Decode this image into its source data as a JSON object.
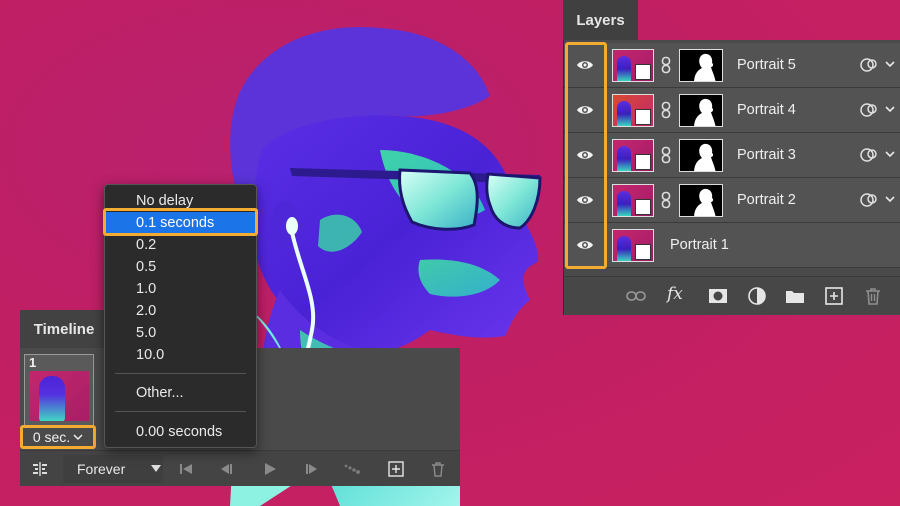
{
  "colors": {
    "background": "#c01f63",
    "panel": "#4a4a4a",
    "highlight_orange": "#f4ab31",
    "menu_selected_blue": "#1b74e8"
  },
  "layers_panel": {
    "title": "Layers",
    "layers": [
      {
        "name": "Portrait 5",
        "visible": true,
        "has_mask": true
      },
      {
        "name": "Portrait 4",
        "visible": true,
        "has_mask": true
      },
      {
        "name": "Portrait 3",
        "visible": true,
        "has_mask": true
      },
      {
        "name": "Portrait 2",
        "visible": true,
        "has_mask": true
      },
      {
        "name": "Portrait 1",
        "visible": true,
        "has_mask": false
      }
    ],
    "footer_icons": [
      "link-icon",
      "fx-icon",
      "add-mask-icon",
      "adjustment-layer-icon",
      "new-group-icon",
      "new-layer-icon",
      "trash-icon"
    ],
    "fx_label": "fx"
  },
  "timeline_panel": {
    "title": "Timeline",
    "frames": [
      {
        "number": "1",
        "delay": "0 sec."
      }
    ],
    "loop_option": "Forever",
    "controls": [
      "convert-to-video-icon",
      "first-frame-icon",
      "previous-frame-icon",
      "play-icon",
      "next-frame-icon",
      "tween-icon",
      "duplicate-frame-icon",
      "trash-icon"
    ]
  },
  "delay_menu": {
    "items": [
      {
        "label": "No delay",
        "selected": false
      },
      {
        "label": "0.1 seconds",
        "selected": true
      },
      {
        "label": "0.2",
        "selected": false
      },
      {
        "label": "0.5",
        "selected": false
      },
      {
        "label": "1.0",
        "selected": false
      },
      {
        "label": "2.0",
        "selected": false
      },
      {
        "label": "5.0",
        "selected": false
      },
      {
        "label": "10.0",
        "selected": false
      }
    ],
    "other_label": "Other...",
    "current_label": "0.00 seconds"
  }
}
